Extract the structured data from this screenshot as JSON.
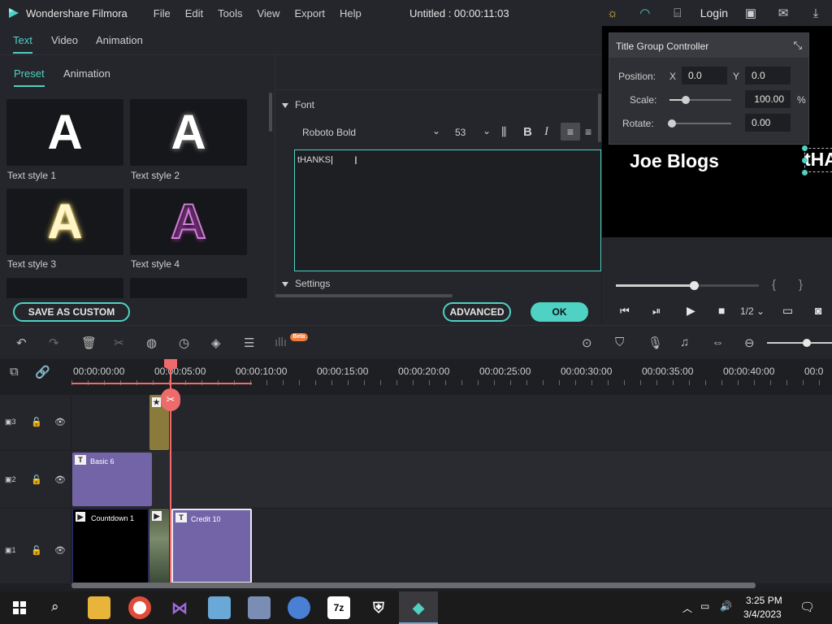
{
  "titlebar": {
    "app_name": "Wondershare Filmora",
    "menu": [
      "File",
      "Edit",
      "Tools",
      "View",
      "Export",
      "Help"
    ],
    "doc_title": "Untitled : 00:00:11:03",
    "login": "Login",
    "icons": [
      "lightbulb-icon",
      "headset-icon",
      "gift-icon",
      "save-icon",
      "mail-icon",
      "download-icon"
    ]
  },
  "editor_tabs": [
    "Text",
    "Video",
    "Animation"
  ],
  "sub_tabs": [
    "Preset",
    "Animation"
  ],
  "text_styles": [
    {
      "label": "Text style 1",
      "color": "#ffffff"
    },
    {
      "label": "Text style 2",
      "color": "#ffffff"
    },
    {
      "label": "Text style 3",
      "color": "#fff6c8"
    },
    {
      "label": "Text style 4",
      "color": "#cf7fd6"
    }
  ],
  "font_panel": {
    "section_font": "Font",
    "font_name": "Roboto Bold",
    "font_size": "53",
    "bold": "B",
    "italic": "I",
    "text_value": "tHANKS",
    "section_settings": "Settings"
  },
  "buttons": {
    "save_custom": "SAVE AS CUSTOM",
    "advanced": "ADVANCED",
    "ok": "OK"
  },
  "title_group_controller": {
    "title": "Title Group Controller",
    "position_label": "Position:",
    "x_label": "X",
    "x_value": "0.0",
    "y_label": "Y",
    "y_value": "0.0",
    "scale_label": "Scale:",
    "scale_value": "100.00",
    "scale_unit": "%",
    "rotate_label": "Rotate:",
    "rotate_value": "0.00"
  },
  "preview": {
    "text_joe": "Joe Blogs",
    "text_ha": "tHA",
    "mark_in": "{",
    "mark_out": "}",
    "quality": "1/2",
    "progress": 0.55
  },
  "timeline": {
    "beta": "Beta",
    "timecodes": [
      "00:00:00:00",
      "00:00:05:00",
      "00:00:10:00",
      "00:00:15:00",
      "00:00:20:00",
      "00:00:25:00",
      "00:00:30:00",
      "00:00:35:00",
      "00:00:40:00",
      "00:0"
    ],
    "tracks": [
      "3",
      "2",
      "1"
    ],
    "clips": {
      "basic6": "Basic 6",
      "countdown1": "Countdown 1",
      "credit10": "Credit 10"
    }
  },
  "taskbar": {
    "time": "3:25 PM",
    "date": "3/4/2023",
    "apps": [
      "file-explorer-icon",
      "chrome-icon",
      "visual-studio-icon",
      "control-panel-icon",
      "network-icon",
      "chromium-icon",
      "7zip-icon",
      "security-icon",
      "filmora-icon"
    ]
  }
}
